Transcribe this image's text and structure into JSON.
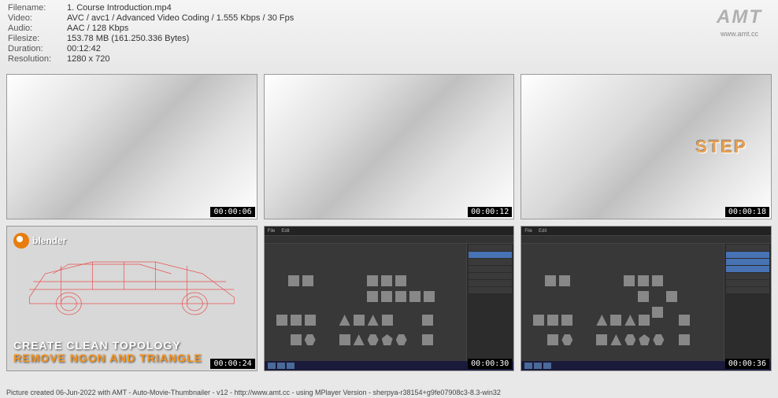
{
  "header": {
    "filename_label": "Filename:",
    "filename_value": "1. Course Introduction.mp4",
    "video_label": "Video:",
    "video_value": "AVC / avc1 / Advanced Video Coding / 1.555 Kbps / 30 Fps",
    "audio_label": "Audio:",
    "audio_value": "AAC / 128 Kbps",
    "filesize_label": "Filesize:",
    "filesize_value": "153.78 MB (161.250.336 Bytes)",
    "duration_label": "Duration:",
    "duration_value": "00:12:42",
    "resolution_label": "Resolution:",
    "resolution_value": "1280 x 720"
  },
  "logo": {
    "text": "AMT",
    "url": "www.amt.cc"
  },
  "thumbnails": [
    {
      "timestamp": "00:00:06"
    },
    {
      "timestamp": "00:00:12"
    },
    {
      "timestamp": "00:00:18",
      "overlay": "STEP"
    },
    {
      "timestamp": "00:00:24",
      "blender": "blender",
      "line1": "CREATE CLEAN TOPOLOGY",
      "line2": "REMOVE NGON AND TRIANGLE"
    },
    {
      "timestamp": "00:00:30"
    },
    {
      "timestamp": "00:00:36"
    }
  ],
  "footer": "Picture created 06-Jun-2022 with AMT - Auto-Movie-Thumbnailer - v12 - http://www.amt.cc - using MPlayer Version - sherpya-r38154+g9fe07908c3-8.3-win32"
}
